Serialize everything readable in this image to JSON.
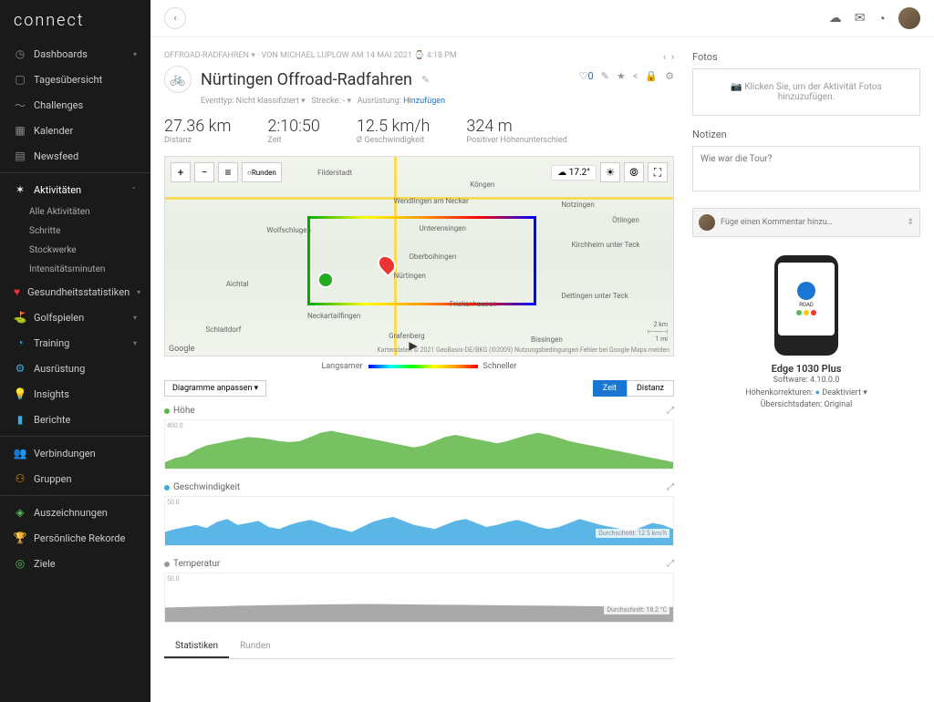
{
  "brand": "connect",
  "nav": {
    "dashboards": "Dashboards",
    "tagesubersicht": "Tagesübersicht",
    "challenges": "Challenges",
    "kalender": "Kalender",
    "newsfeed": "Newsfeed",
    "aktivitaten": "Aktivitäten",
    "alle_aktivitaten": "Alle Aktivitäten",
    "schritte": "Schritte",
    "stockwerke": "Stockwerke",
    "intensitatsminuten": "Intensitätsminuten",
    "gesundheit": "Gesundheitsstatistiken",
    "golfspielen": "Golfspielen",
    "training": "Training",
    "ausrustung": "Ausrüstung",
    "insights": "Insights",
    "berichte": "Berichte",
    "verbindungen": "Verbindungen",
    "gruppen": "Gruppen",
    "auszeichnungen": "Auszeichnungen",
    "rekorde": "Persönliche Rekorde",
    "ziele": "Ziele"
  },
  "breadcrumb": "OFFROAD-RADFAHREN ▾ · VON MICHAEL LUPLOW AM 14 MAI 2021 ⌚ 4:18 PM",
  "title": "Nürtingen Offroad-Radfahren",
  "meta": {
    "eventtyp_lbl": "Eventtyp:",
    "eventtyp_val": "Nicht klassifiziert ▾",
    "strecke_lbl": "Strecke:",
    "strecke_val": "- ▾",
    "ausrustung_lbl": "Ausrüstung:",
    "ausrustung_link": "Hinzufügen"
  },
  "favorite_count": "0",
  "stats": [
    {
      "val": "27.36 km",
      "lbl": "Distanz"
    },
    {
      "val": "2:10:50",
      "lbl": "Zeit"
    },
    {
      "val": "12.5 km/h",
      "lbl": "Ø Geschwindigkeit"
    },
    {
      "val": "324 m",
      "lbl": "Positiver Höhenunterschied"
    }
  ],
  "map": {
    "temp": "17.2°",
    "labels": [
      "Filderstadt",
      "Wolfschlugen",
      "Aichtal",
      "Schlaitdorf",
      "Neckartailfingen",
      "Oberboihingen",
      "Köngen",
      "Wendlingen am Neckar",
      "Unterensingen",
      "Nürtingen",
      "Frickenhausen",
      "Grafenberg",
      "Bissingen",
      "Kirchheim unter Teck",
      "Dettingen unter Teck",
      "Notzingen",
      "Ötlingen"
    ],
    "scale1": "2 km",
    "scale2": "1 mi",
    "google": "Google",
    "attrib": "Kartendaten © 2021 GeoBasis-DE/BKG (©2009)   Nutzungsbedingungen   Fehler bei Google Maps melden",
    "runden": "Runden"
  },
  "legend": {
    "slow": "Langsamer",
    "fast": "Schneller"
  },
  "chart_controls": {
    "customize": "Diagramme anpassen ▾",
    "zeit": "Zeit",
    "distanz": "Distanz"
  },
  "chart_data": [
    {
      "type": "area",
      "title": "Höhe",
      "color": "#5fb648",
      "ylim": [
        280,
        400
      ],
      "values": [
        300,
        310,
        315,
        330,
        340,
        345,
        350,
        355,
        360,
        358,
        355,
        350,
        348,
        350,
        360,
        370,
        375,
        370,
        365,
        360,
        355,
        350,
        345,
        340,
        335,
        340,
        350,
        360,
        365,
        360,
        355,
        350,
        345,
        350,
        358,
        365,
        370,
        365,
        358,
        350,
        345,
        340,
        335,
        330,
        325,
        320,
        315,
        310,
        305,
        300
      ]
    },
    {
      "type": "area",
      "title": "Geschwindigkeit",
      "color": "#3fa9e0",
      "ylim": [
        0,
        50
      ],
      "avg_label": "Durchschnitt: 12.5 km/h",
      "values": [
        15,
        18,
        20,
        22,
        19,
        25,
        28,
        22,
        24,
        26,
        20,
        18,
        22,
        25,
        27,
        24,
        20,
        18,
        15,
        20,
        25,
        28,
        30,
        26,
        22,
        20,
        18,
        22,
        26,
        28,
        24,
        20,
        22,
        25,
        27,
        24,
        20,
        18,
        20,
        24,
        28,
        25,
        22,
        20,
        18,
        16,
        20,
        24,
        22,
        18
      ]
    },
    {
      "type": "area",
      "title": "Temperatur",
      "color": "#9a9a9a",
      "ylim": [
        0,
        50
      ],
      "avg_label": "Durchschnitt: 18.2 °C",
      "values": [
        16,
        16.2,
        16.5,
        16.8,
        17,
        17.2,
        17.5,
        17.8,
        18,
        18.2,
        18.4,
        18.5,
        18.6,
        18.8,
        19,
        19.1,
        19.2,
        19.3,
        19.4,
        19.5,
        19.5,
        19.4,
        19.3,
        19.2,
        19.1,
        19,
        18.9,
        18.8,
        18.7,
        18.6,
        18.5,
        18.4,
        18.3,
        18.2,
        18.1,
        18,
        17.9,
        17.8,
        17.7,
        17.6,
        17.5,
        17.4,
        17.3,
        17.2,
        17.1,
        17,
        16.9,
        16.8,
        16.7,
        16.5
      ]
    }
  ],
  "tabs": {
    "statistiken": "Statistiken",
    "runden": "Runden"
  },
  "right": {
    "fotos": "Fotos",
    "fotos_add": "Klicken Sie, um der Aktivität Fotos hinzuzufügen.",
    "notizen": "Notizen",
    "notizen_placeholder": "Wie war die Tour?",
    "comment_placeholder": "Füge einen Kommentar hinzu…"
  },
  "device": {
    "name": "Edge 1030 Plus",
    "software": "Software: 4.10.0.0",
    "hohenkorrekturen_lbl": "Höhenkorrekturen:",
    "hohenkorrekturen_val": "Deaktiviert ▾",
    "ubersicht": "Übersichtsdaten: Original",
    "screen_label": "ROAD"
  }
}
